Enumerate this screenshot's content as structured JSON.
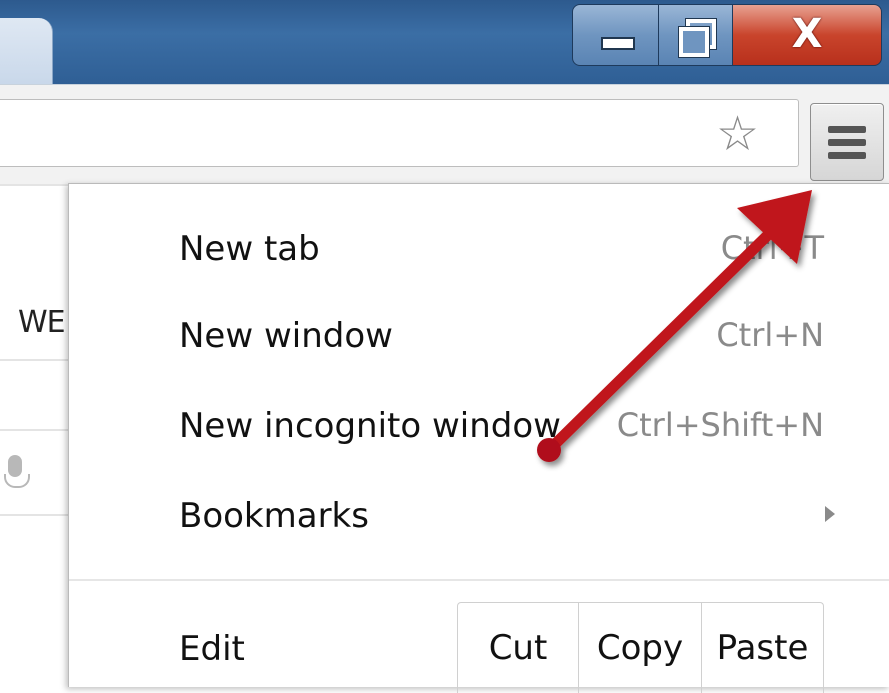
{
  "window": {
    "close_glyph": "X"
  },
  "toolbar": {
    "star_glyph": "☆",
    "menu_icon": "hamburger-menu-icon"
  },
  "page": {
    "partial_text": "WE"
  },
  "menu": {
    "items": [
      {
        "label": "New tab",
        "accel": "Ctrl+T"
      },
      {
        "label": "New window",
        "accel": "Ctrl+N"
      },
      {
        "label": "New incognito window",
        "accel": "Ctrl+Shift+N"
      },
      {
        "label": "Bookmarks",
        "accel": ""
      }
    ],
    "edit": {
      "label": "Edit",
      "cut": "Cut",
      "copy": "Copy",
      "paste": "Paste"
    }
  },
  "colors": {
    "titlebar": "#2f5f95",
    "close_button": "#c9442c",
    "annotation_arrow": "#c0141a"
  }
}
